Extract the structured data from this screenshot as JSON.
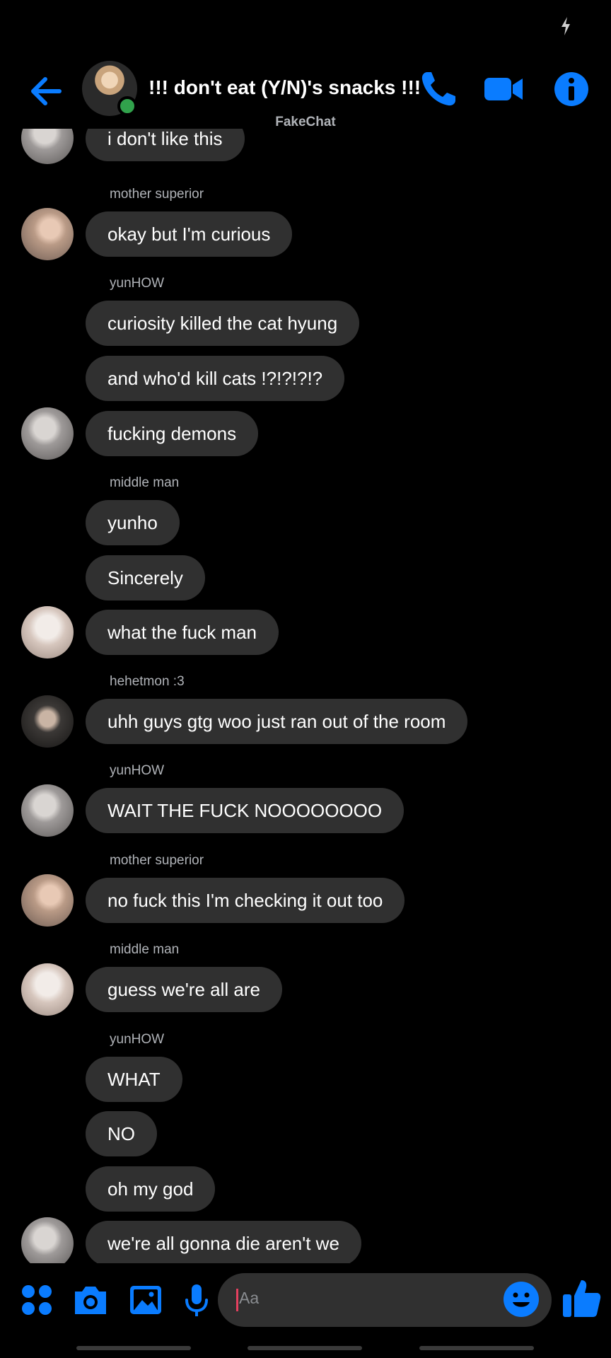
{
  "app": {
    "accent": "#0a7cff",
    "bubble_color": "#303030",
    "background": "#000000"
  },
  "header": {
    "title": "!!! don't eat (Y/N)'s snacks !!!",
    "subtitle": "FakeChat",
    "icons": [
      "back-arrow-icon",
      "phone-icon",
      "video-camera-icon",
      "info-icon"
    ]
  },
  "messages": [
    {
      "sender": "",
      "text": "i don't like this",
      "avatar": true
    },
    {
      "sender": "mother superior",
      "text": "okay but I'm curious",
      "avatar": true
    },
    {
      "sender": "yunHOW",
      "text": "curiosity killed the cat hyung",
      "avatar": false
    },
    {
      "sender": "",
      "text": "and who'd kill cats !?!?!?!?",
      "avatar": false
    },
    {
      "sender": "",
      "text": "fucking demons",
      "avatar": true
    },
    {
      "sender": "middle man",
      "text": "yunho",
      "avatar": false
    },
    {
      "sender": "",
      "text": "Sincerely",
      "avatar": false
    },
    {
      "sender": "",
      "text": "what the fuck man",
      "avatar": true
    },
    {
      "sender": "hehetmon :3",
      "text": "uhh guys gtg woo just ran out of the room",
      "avatar": true
    },
    {
      "sender": "yunHOW",
      "text": "WAIT THE FUCK NOOOOOOOO",
      "avatar": true
    },
    {
      "sender": "mother superior",
      "text": "no fuck this I'm checking it out too",
      "avatar": true
    },
    {
      "sender": "middle man",
      "text": "guess we're all are",
      "avatar": true
    },
    {
      "sender": "yunHOW",
      "text": "WHAT",
      "avatar": false
    },
    {
      "sender": "",
      "text": "NO",
      "avatar": false
    },
    {
      "sender": "",
      "text": "oh my god",
      "avatar": false
    },
    {
      "sender": "",
      "text": "we're all gonna die aren't we",
      "avatar": true
    }
  ],
  "composer": {
    "placeholder": "Aa",
    "icons": [
      "apps-icon",
      "camera-icon",
      "gallery-icon",
      "microphone-icon",
      "emoji-icon",
      "thumbs-up-icon"
    ]
  }
}
